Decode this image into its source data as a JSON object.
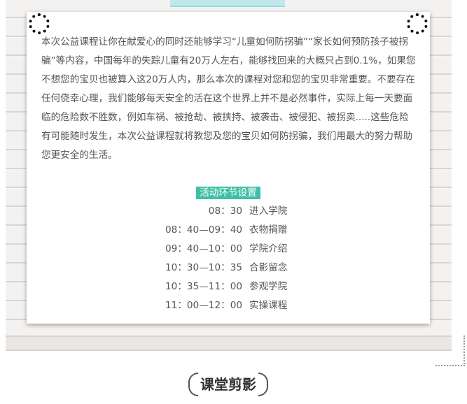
{
  "intro": {
    "text": "本次公益课程让你在献爱心的同时还能够学习“儿童如何防拐骗”“家长如何预防孩子被拐骗”等内容，中国每年的失踪儿童有20万人左右，能够找回来的大概只占到0.1%，如果您不想您的宝贝也被算入这20万人内，那么本次的课程对您和您的宝贝非常重要。不要存在任何侥幸心理，我们能够每天安全的活在这个世界上并不是必然事件，实际上每一天要面临的危险数不胜数，例如车祸、被抢劫、被挟持、被袭击、被侵犯、被拐卖.....这些危险有可能随时发生，本次公益课程就将教您及您的宝贝如何防拐骗，我们用最大的努力帮助您更安全的生活。"
  },
  "schedule": {
    "title": "活动环节设置",
    "items": [
      {
        "time": "08：30",
        "activity": "进入学院"
      },
      {
        "time": "08：40—09：40",
        "activity": "衣物捐赠"
      },
      {
        "time": "09：40—10：00",
        "activity": "学院介绍"
      },
      {
        "time": "10：30—10：35",
        "activity": "合影留念"
      },
      {
        "time": "10：35—11：00",
        "activity": "参观学院"
      },
      {
        "time": "11：00—12：00",
        "activity": "实操课程"
      }
    ]
  },
  "footer": {
    "title": "课堂剪影"
  },
  "colors": {
    "accent": "#3fbfa7",
    "text": "#555555",
    "tape": "#bfe9ea"
  }
}
